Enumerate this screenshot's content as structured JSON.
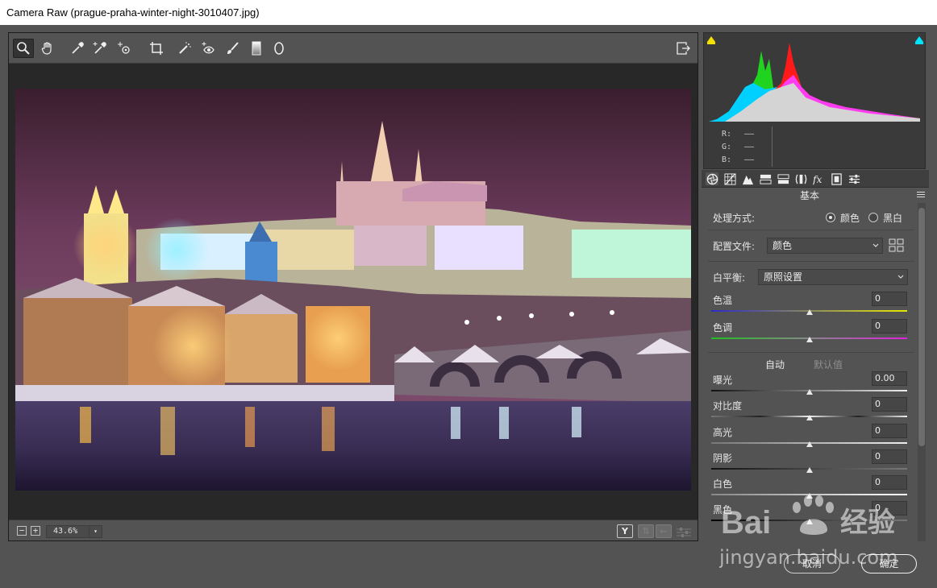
{
  "window": {
    "title": "Camera Raw (prague-praha-winter-night-3010407.jpg)"
  },
  "toolbar": {
    "tools": [
      {
        "name": "zoom-tool",
        "icon": "magnifier-icon"
      },
      {
        "name": "hand-tool",
        "icon": "hand-icon"
      },
      {
        "name": "white-balance-tool",
        "icon": "eyedropper-icon"
      },
      {
        "name": "color-sampler-tool",
        "icon": "color-sampler-icon"
      },
      {
        "name": "targeted-adjustment-tool",
        "icon": "targeted-adjustment-icon"
      },
      {
        "name": "crop-tool",
        "icon": "crop-icon"
      },
      {
        "name": "spot-removal-tool",
        "icon": "spot-removal-icon"
      },
      {
        "name": "red-eye-tool",
        "icon": "red-eye-icon"
      },
      {
        "name": "adjustment-brush-tool",
        "icon": "brush-icon"
      },
      {
        "name": "graduated-filter-tool",
        "icon": "graduated-filter-icon"
      },
      {
        "name": "radial-filter-tool",
        "icon": "radial-filter-icon"
      }
    ],
    "right_icon": "toggle-fullscreen-icon"
  },
  "status": {
    "zoom_out": "−",
    "zoom_in": "+",
    "zoom_value": "43.6%",
    "before_after_label": "Y"
  },
  "histogram": {
    "r_label": "R:",
    "g_label": "G:",
    "b_label": "B:",
    "r_value": "——",
    "g_value": "——",
    "b_value": "——",
    "shadow_clip_color": "#f5e100",
    "highlight_clip_color": "#00e5ff"
  },
  "panel": {
    "section_title": "基本",
    "treatment_label": "处理方式:",
    "treatment_color": "颜色",
    "treatment_bw": "黑白",
    "profile_label": "配置文件:",
    "profile_value": "颜色",
    "wb_label": "白平衡:",
    "wb_value": "原照设置",
    "auto_label": "自动",
    "default_label": "默认值",
    "sliders": [
      {
        "label": "色温",
        "value": "0",
        "position": 0.5
      },
      {
        "label": "色调",
        "value": "0",
        "position": 0.5
      },
      {
        "label": "曝光",
        "value": "0.00",
        "position": 0.5
      },
      {
        "label": "对比度",
        "value": "0",
        "position": 0.5
      },
      {
        "label": "高光",
        "value": "0",
        "position": 0.5
      },
      {
        "label": "阴影",
        "value": "0",
        "position": 0.5
      },
      {
        "label": "白色",
        "value": "0",
        "position": 0.5
      },
      {
        "label": "黑色",
        "value": "0",
        "position": 0.5
      }
    ]
  },
  "buttons": {
    "cancel": "取消",
    "ok": "确定"
  },
  "watermark": {
    "brand": "Bai",
    "brand_cn": "经验",
    "url": "jingyan.baidu.com"
  },
  "colors": {
    "panel_bg": "#535353",
    "canvas_bg": "#282828",
    "accent_link": "#8f8f8f"
  }
}
